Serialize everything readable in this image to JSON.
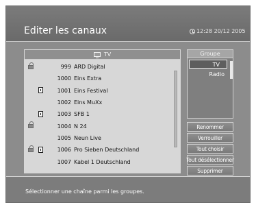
{
  "header": {
    "title": "Editer les canaux",
    "clock": "12:28 20/12 2005"
  },
  "list": {
    "title": "TV",
    "channels": [
      {
        "number": "999",
        "name": "ARD Digital",
        "locked": true,
        "favorite": false
      },
      {
        "number": "1000",
        "name": "Eins Extra",
        "locked": false,
        "favorite": false
      },
      {
        "number": "1001",
        "name": "Eins Festival",
        "locked": false,
        "favorite": true
      },
      {
        "number": "1002",
        "name": "Eins MuXx",
        "locked": false,
        "favorite": false
      },
      {
        "number": "1003",
        "name": "SFB 1",
        "locked": false,
        "favorite": true
      },
      {
        "number": "1004",
        "name": "N 24",
        "locked": true,
        "favorite": false
      },
      {
        "number": "1005",
        "name": "Neun Live",
        "locked": false,
        "favorite": false
      },
      {
        "number": "1006",
        "name": "Pro Sieben Deutschland",
        "locked": true,
        "favorite": true
      },
      {
        "number": "1007",
        "name": "Kabel 1 Deutschland",
        "locked": false,
        "favorite": false
      }
    ]
  },
  "groups": {
    "title": "Groupe",
    "items": [
      "TV",
      "Radio"
    ],
    "selected": "TV"
  },
  "buttons": {
    "rename": "Renommer",
    "lock": "Verrouiller",
    "select_all": "Tout choisir",
    "deselect_all": "Tout désélectionner",
    "delete": "Supprimer"
  },
  "footer": {
    "hint": "Sélectionner une chaîne parmi les groupes."
  }
}
